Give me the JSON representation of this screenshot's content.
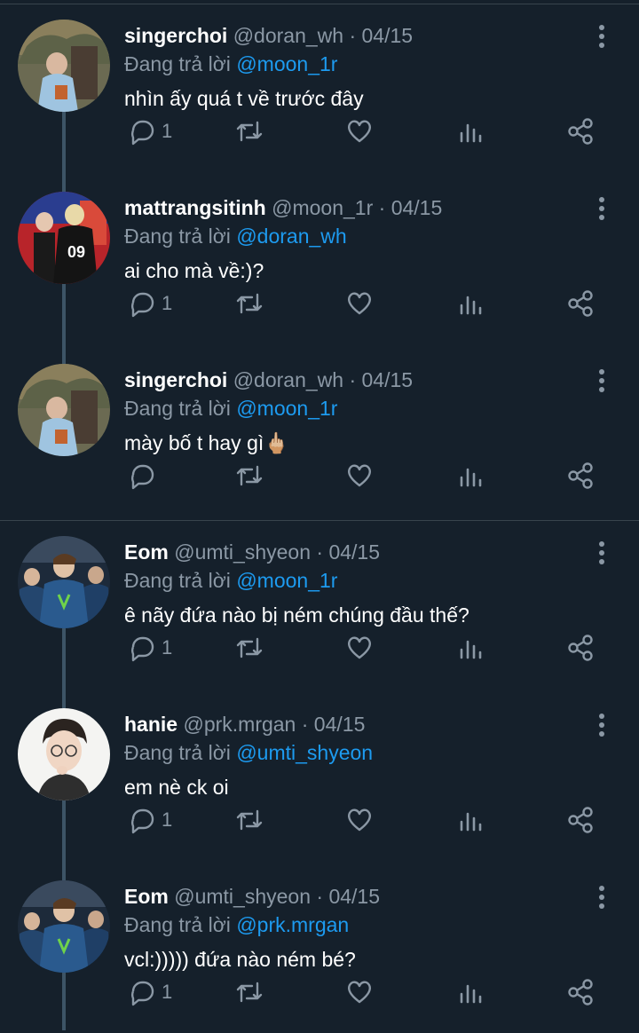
{
  "theme": {
    "background": "#15202b",
    "accent": "#1d9bf0",
    "muted": "#8b98a5",
    "thread_line": "#3d5466"
  },
  "reply_prefix": "Đang trả lời",
  "tweets": [
    {
      "name": "singerchoi",
      "handle": "@doran_wh",
      "date": "· 04/15",
      "reply_to": "@moon_1r",
      "text": "nhìn ấy quá t về trước đây",
      "reply_count": "1",
      "avatar": "avatar-singerchoi"
    },
    {
      "name": "mattrangsitinh",
      "handle": "@moon_1r",
      "date": "· 04/15",
      "reply_to": "@doran_wh",
      "text": "ai cho mà về:)?",
      "reply_count": "1",
      "avatar": "avatar-mattrangsitinh"
    },
    {
      "name": "singerchoi",
      "handle": "@doran_wh",
      "date": "· 04/15",
      "reply_to": "@moon_1r",
      "text": "mày bố t hay gì🖕🏼",
      "reply_count": "",
      "avatar": "avatar-singerchoi"
    },
    {
      "name": "Eom",
      "handle": "@umti_shyeon",
      "date": "· 04/15",
      "reply_to": "@moon_1r",
      "text": "ê nãy đứa nào bị ném chúng đầu thế?",
      "reply_count": "1",
      "avatar": "avatar-eom"
    },
    {
      "name": "hanie",
      "handle": "@prk.mrgan",
      "date": "· 04/15",
      "reply_to": "@umti_shyeon",
      "text": "em nè ck oi",
      "reply_count": "1",
      "avatar": "avatar-hanie"
    },
    {
      "name": "Eom",
      "handle": "@umti_shyeon",
      "date": "· 04/15",
      "reply_to": "@prk.mrgan",
      "text": "vcl:))))) đứa nào ném bé?",
      "reply_count": "1",
      "avatar": "avatar-eom"
    }
  ],
  "icons": {
    "reply": "comment-icon",
    "retweet": "retweet-icon",
    "like": "heart-icon",
    "analytics": "analytics-icon",
    "share": "share-icon",
    "more": "more-vertical-icon"
  }
}
